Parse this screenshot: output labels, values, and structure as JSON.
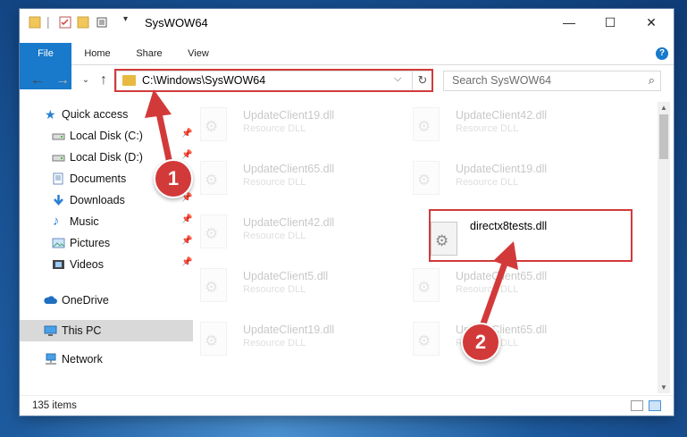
{
  "window": {
    "title": "SysWOW64",
    "controls": {
      "minimize": "—",
      "maximize": "☐",
      "close": "✕"
    }
  },
  "ribbon": {
    "tabs": [
      "File",
      "Home",
      "Share",
      "View"
    ],
    "help": "?"
  },
  "address_bar": {
    "path": "C:\\Windows\\SysWOW64",
    "dropdown": "⌵",
    "refresh": "↻"
  },
  "search": {
    "placeholder": "Search SysWOW64",
    "icon": "search-icon"
  },
  "nav_pane": {
    "items": [
      {
        "label": "Quick access",
        "icon": "star-icon",
        "pinned": false
      },
      {
        "label": "Local Disk (C:)",
        "icon": "drive-icon",
        "pinned": true
      },
      {
        "label": "Local Disk (D:)",
        "icon": "drive-icon",
        "pinned": true
      },
      {
        "label": "Documents",
        "icon": "documents-icon",
        "pinned": true
      },
      {
        "label": "Downloads",
        "icon": "download-icon",
        "pinned": true
      },
      {
        "label": "Music",
        "icon": "music-icon",
        "pinned": true
      },
      {
        "label": "Pictures",
        "icon": "pictures-icon",
        "pinned": true
      },
      {
        "label": "Videos",
        "icon": "videos-icon",
        "pinned": true
      },
      {
        "label": "OneDrive",
        "icon": "cloud-icon",
        "pinned": false
      },
      {
        "label": "This PC",
        "icon": "computer-icon",
        "pinned": false,
        "selected": true
      },
      {
        "label": "Network",
        "icon": "network-icon",
        "pinned": false
      }
    ]
  },
  "files": {
    "left": [
      {
        "name": "UpdateClient19.dll",
        "type": "Resource DLL"
      },
      {
        "name": "UpdateClient65.dll",
        "type": "Resource DLL"
      },
      {
        "name": "UpdateClient42.dll",
        "type": "Resource DLL"
      },
      {
        "name": "UpdateClient5.dll",
        "type": "Resource DLL"
      },
      {
        "name": "UpdateClient19.dll",
        "type": "Resource DLL"
      }
    ],
    "right": [
      {
        "name": "UpdateClient42.dll",
        "type": "Resource DLL"
      },
      {
        "name": "UpdateClient19.dll",
        "type": "Resource DLL"
      },
      {
        "name": "directx8tests.dll",
        "type": "",
        "highlighted": true
      },
      {
        "name": "UpdateClient65.dll",
        "type": "Resource DLL"
      },
      {
        "name": "UpdateClient65.dll",
        "type": "Resource DLL"
      }
    ]
  },
  "status_bar": {
    "item_count": "135 items"
  },
  "annotations": {
    "step1": "1",
    "step2": "2",
    "accent": "#d23a3a"
  }
}
